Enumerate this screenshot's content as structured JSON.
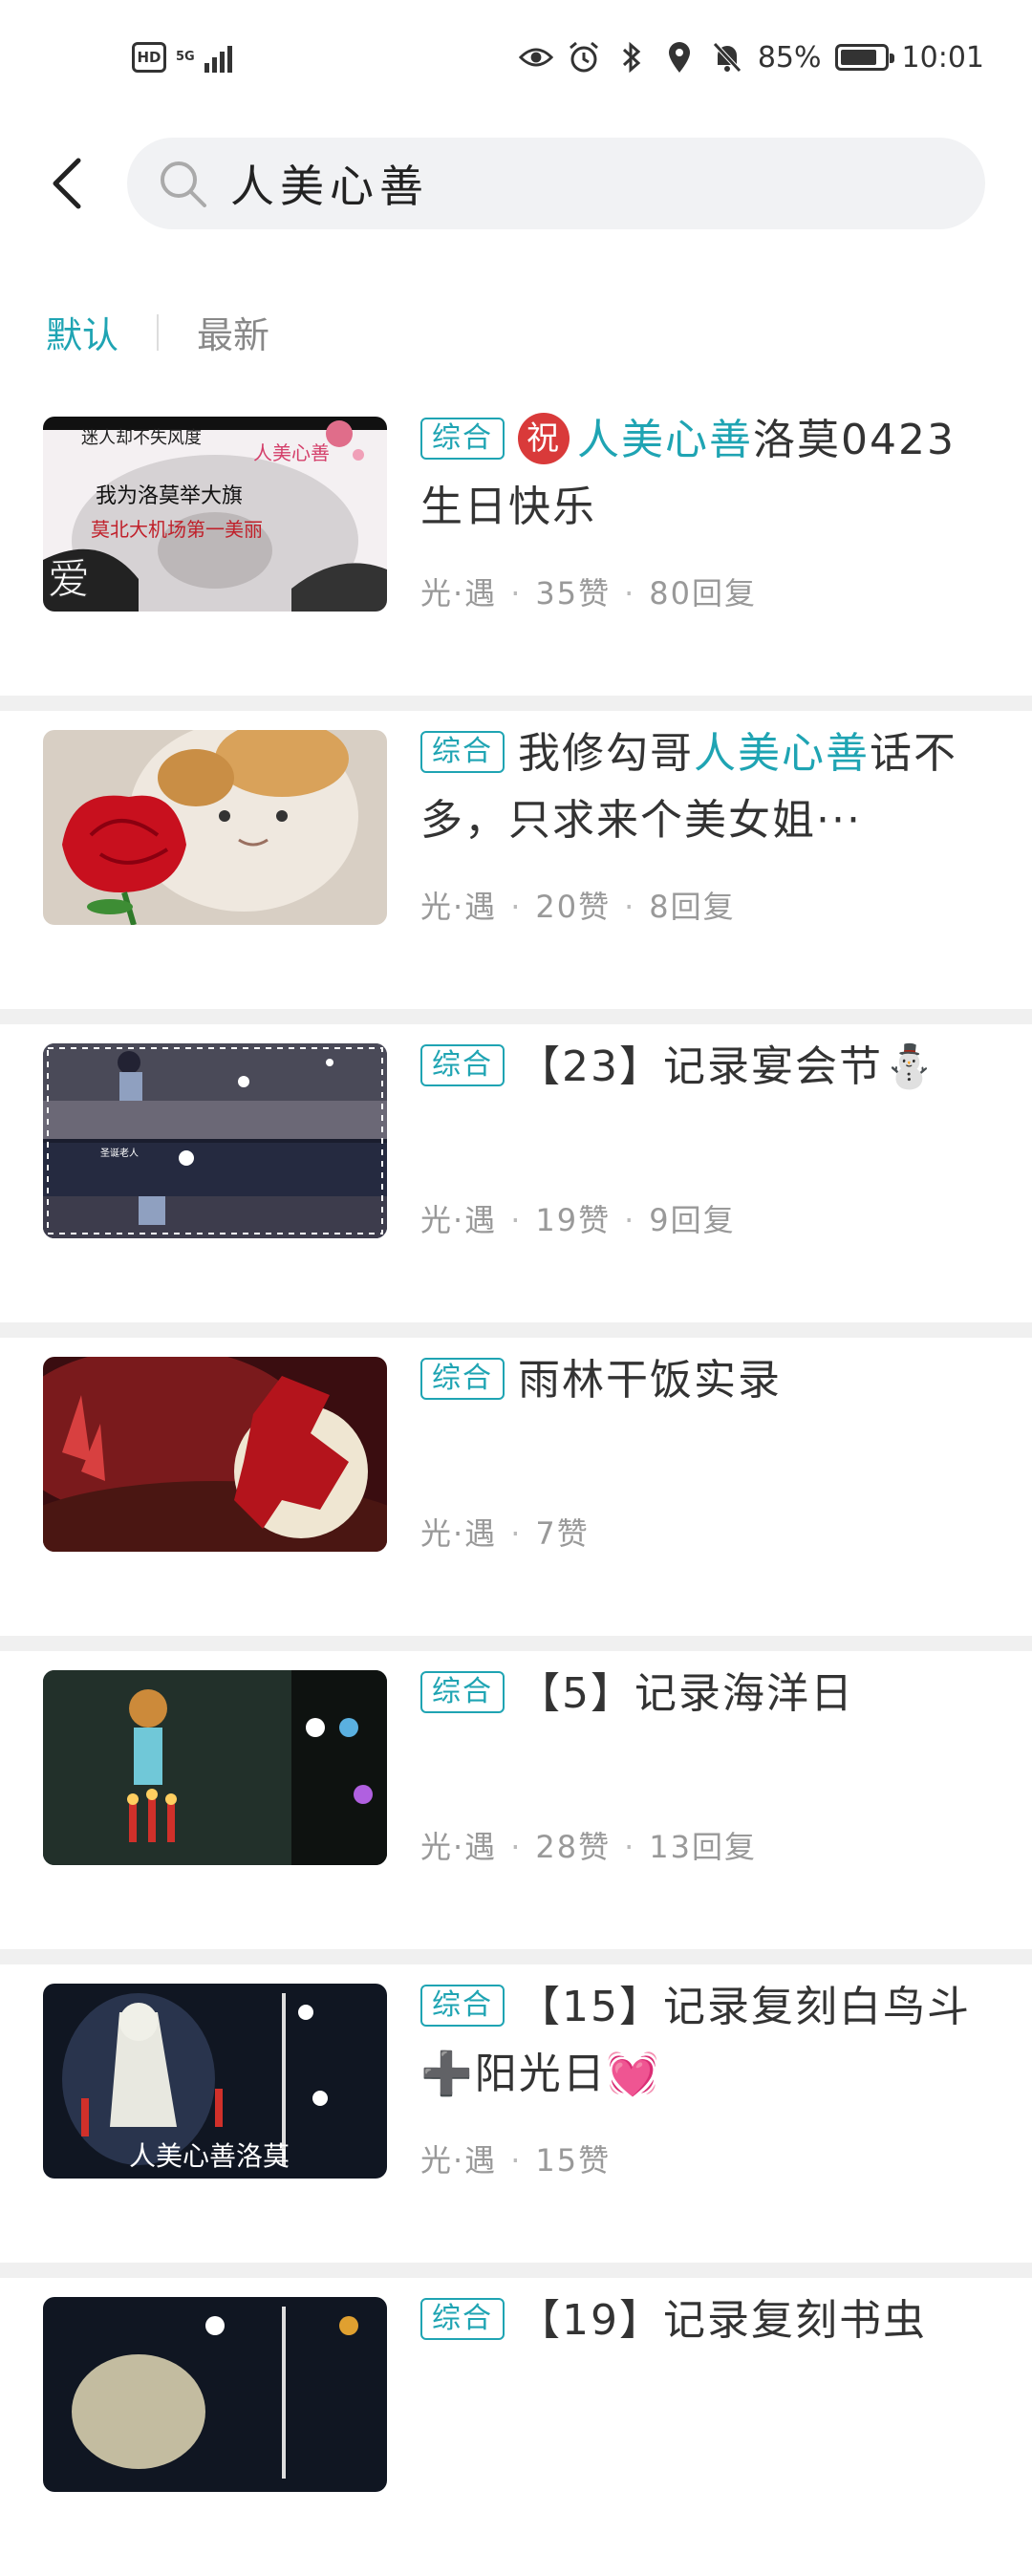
{
  "status_bar": {
    "hd": "HD",
    "network": "5G",
    "battery_percent": "85%",
    "battery_level": 0.85,
    "time": "10:01"
  },
  "header": {
    "search_text": "人美心善"
  },
  "sort_tabs": {
    "default": "默认",
    "latest": "最新"
  },
  "posts": [
    {
      "tag": "综合",
      "title_parts": [
        "祝",
        "人美心善",
        "洛莫0423生日快乐"
      ],
      "meta": {
        "source": "光·遇",
        "likes": "35赞",
        "replies": "80回复"
      }
    },
    {
      "tag": "综合",
      "title_parts": [
        "我修勾哥",
        "人美心善",
        "话不多，只求来个美女姐···"
      ],
      "meta": {
        "source": "光·遇",
        "likes": "20赞",
        "replies": "8回复"
      }
    },
    {
      "tag": "综合",
      "title": "【23】记录宴会节⛄",
      "meta": {
        "source": "光·遇",
        "likes": "19赞",
        "replies": "9回复"
      }
    },
    {
      "tag": "综合",
      "title": "雨林干饭实录",
      "meta": {
        "source": "光·遇",
        "likes": "7赞"
      }
    },
    {
      "tag": "综合",
      "title": "【5】记录海洋日",
      "meta": {
        "source": "光·遇",
        "likes": "28赞",
        "replies": "13回复"
      }
    },
    {
      "tag": "综合",
      "title": "【15】记录复刻白鸟斗➕阳光日💓",
      "meta": {
        "source": "光·遇",
        "likes": "15赞"
      }
    },
    {
      "tag": "综合",
      "title": "【19】记录复刻书虫"
    }
  ],
  "thumb_texts": {
    "t1_lines": [
      "迷人却不失风度",
      "人美心善",
      "我为洛莫举大旗",
      "莫北大机场第一美丽",
      "爱"
    ],
    "t6_caption": "人美心善洛莫"
  },
  "colors": {
    "accent": "#1fa4b3",
    "text": "#333333",
    "meta": "#999999",
    "divider": "#f0f0f0"
  }
}
